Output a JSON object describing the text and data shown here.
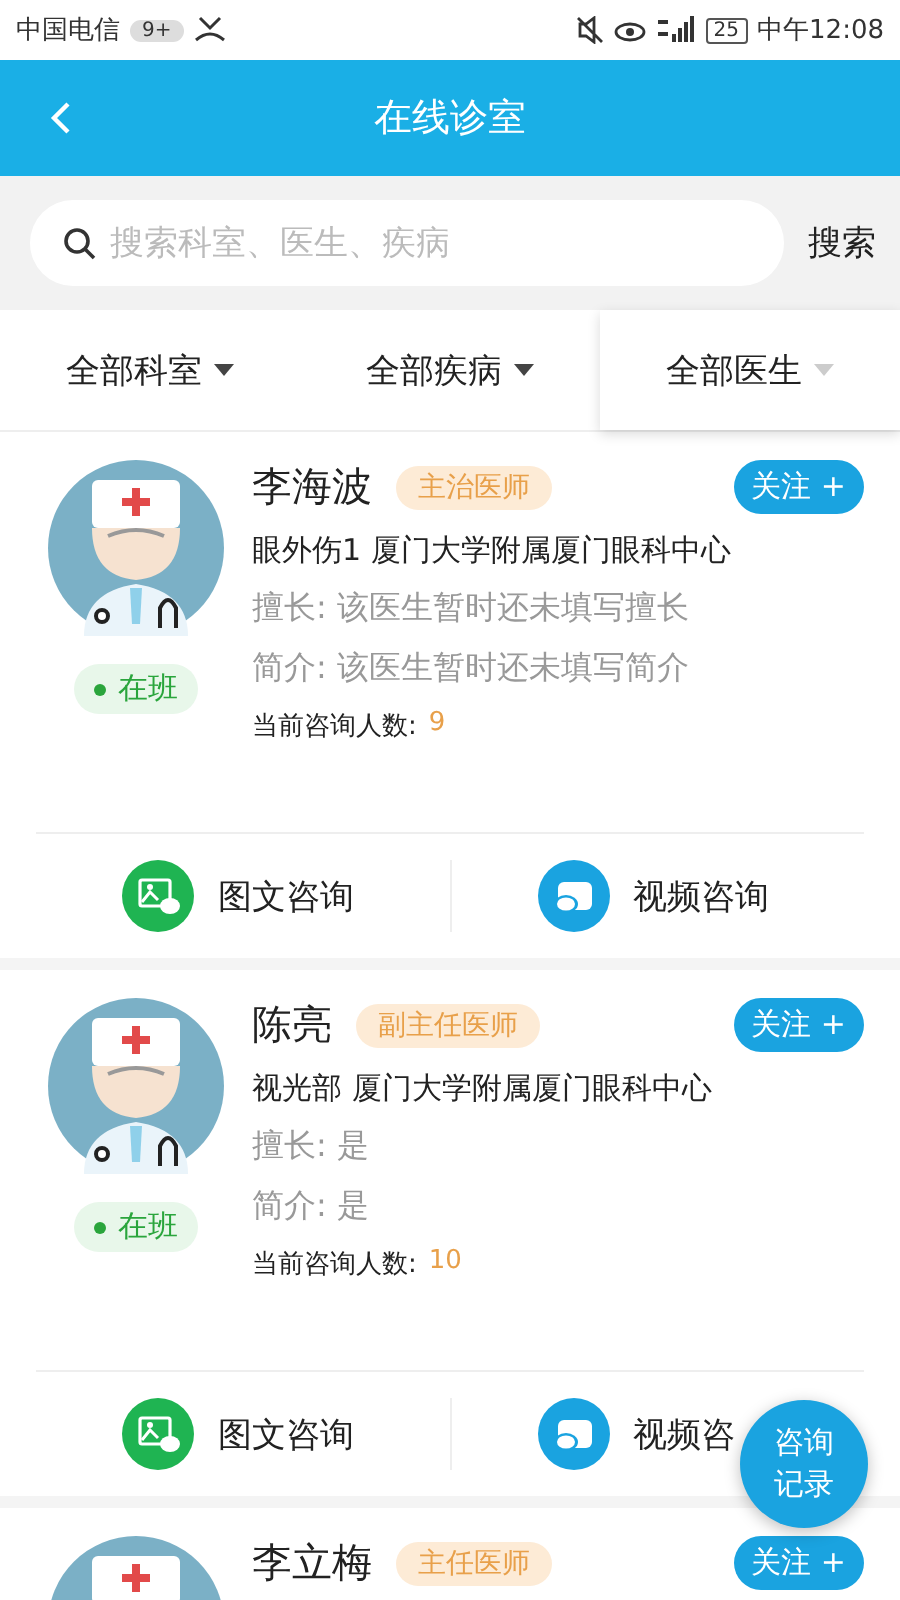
{
  "status_bar": {
    "carrier": "中国电信",
    "badge": "9+",
    "battery": "25",
    "time": "中午12:08"
  },
  "header": {
    "title": "在线诊室"
  },
  "search": {
    "placeholder": "搜索科室、医生、疾病",
    "button": "搜索"
  },
  "filters": [
    {
      "label": "全部科室",
      "selected": false
    },
    {
      "label": "全部疾病",
      "selected": false
    },
    {
      "label": "全部医生",
      "selected": true
    }
  ],
  "doctors": [
    {
      "name": "李海波",
      "title": "主治医师",
      "follow": "关注 +",
      "status": "在班",
      "department": "眼外伤1 厦门大学附属厦门眼科中心",
      "specialty": "擅长: 该医生暂时还未填写擅长",
      "intro": "简介: 该医生暂时还未填写简介",
      "count_label": "当前咨询人数:",
      "count": "9",
      "actions": [
        "图文咨询",
        "视频咨询"
      ]
    },
    {
      "name": "陈亮",
      "title": "副主任医师",
      "follow": "关注 +",
      "status": "在班",
      "department": "视光部 厦门大学附属厦门眼科中心",
      "specialty": "擅长: 是",
      "intro": "简介: 是",
      "count_label": "当前咨询人数:",
      "count": "10",
      "actions": [
        "图文咨询",
        "视频咨"
      ]
    },
    {
      "name": "李立梅",
      "title": "主任医师",
      "follow": "关注 +"
    }
  ],
  "floating_button": {
    "line1": "咨询",
    "line2": "记录"
  }
}
